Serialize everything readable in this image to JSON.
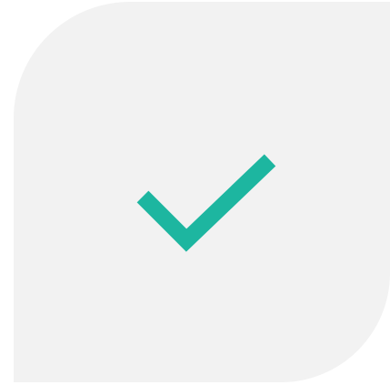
{
  "tile": {
    "background_color": "#f2f2f2"
  },
  "icon": {
    "name": "checkmark-icon",
    "color": "#1db6a0"
  }
}
